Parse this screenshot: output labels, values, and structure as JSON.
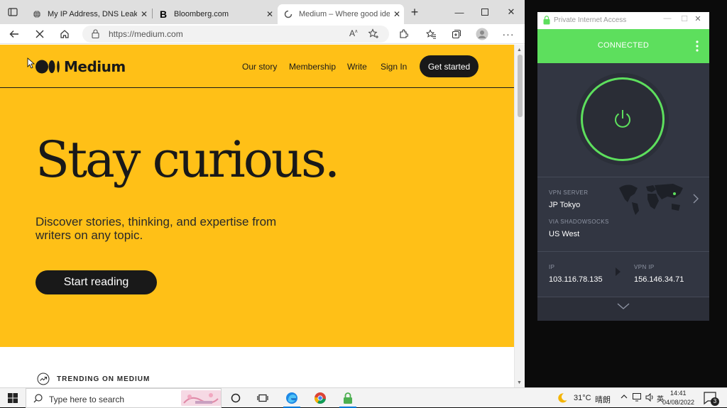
{
  "browser": {
    "tabs": [
      {
        "title": "My IP Address, DNS Leak Tes",
        "favicon": "globe-icon"
      },
      {
        "title": "Bloomberg.com",
        "favicon": "bloomberg-b-icon"
      },
      {
        "title": "Medium – Where good ideas",
        "favicon": "loading-spinner-icon",
        "active": true
      }
    ],
    "new_tab_label": "+",
    "address": "https://medium.com"
  },
  "medium": {
    "logo_text": "Medium",
    "nav": [
      "Our story",
      "Membership",
      "Write",
      "Sign In"
    ],
    "cta_label": "Get started",
    "headline": "Stay curious.",
    "subhead": "Discover stories, thinking, and expertise from writers on any topic.",
    "start_reading_label": "Start reading",
    "trending_label": "TRENDING ON MEDIUM",
    "colors": {
      "hero_bg": "#ffc017",
      "text": "#191919"
    }
  },
  "pia": {
    "window_title": "Private Internet Access",
    "status": "CONNECTED",
    "vpn_server_label": "VPN SERVER",
    "vpn_server": "JP Tokyo",
    "via_label": "VIA SHADOWSOCKS",
    "via_location": "US West",
    "ip_label": "IP",
    "ip": "103.116.78.135",
    "vpn_ip_label": "VPN IP",
    "vpn_ip": "156.146.34.71",
    "colors": {
      "accent": "#5ddf5d",
      "panel": "#323642"
    }
  },
  "taskbar": {
    "search_placeholder": "Type here to search",
    "weather_temp": "31°C",
    "weather_desc": "晴朗",
    "time": "14:41",
    "date": "04/08/2022",
    "notification_count": "3"
  }
}
